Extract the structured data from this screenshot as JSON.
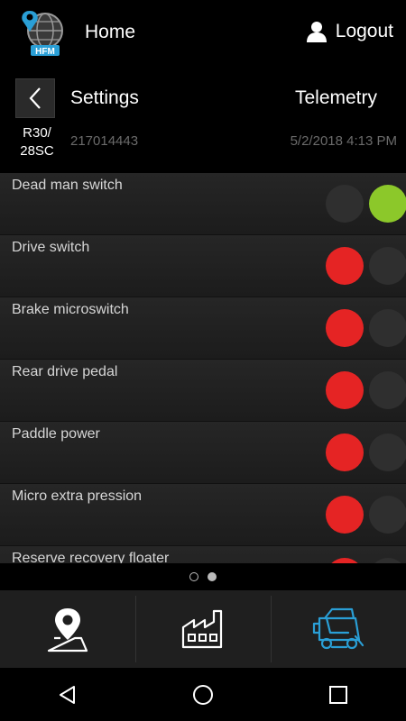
{
  "header": {
    "logo_text": "HFM",
    "home_label": "Home",
    "logout_label": "Logout"
  },
  "subheader": {
    "settings_label": "Settings",
    "telemetry_label": "Telemetry",
    "model": "R30/ 28SC",
    "serial": "217014443",
    "datetime": "5/2/2018 4:13 PM"
  },
  "colors": {
    "led_on_green": "#8cc82a",
    "led_on_red": "#e52424",
    "led_off": "#2f2f2f",
    "accent_blue": "#2a9fd6"
  },
  "switches": [
    {
      "label": "Dead man switch",
      "left": "off",
      "right": "green"
    },
    {
      "label": "Drive switch",
      "left": "red",
      "right": "off"
    },
    {
      "label": "Brake microswitch",
      "left": "red",
      "right": "off"
    },
    {
      "label": "Rear drive pedal",
      "left": "red",
      "right": "off"
    },
    {
      "label": "Paddle power",
      "left": "red",
      "right": "off"
    },
    {
      "label": "Micro extra pression",
      "left": "red",
      "right": "off"
    },
    {
      "label": "Reserve recovery floater",
      "left": "red",
      "right": "off"
    }
  ],
  "pager": {
    "pages": 2,
    "current": 2
  },
  "tabs": [
    {
      "icon": "map-pin-icon"
    },
    {
      "icon": "factory-icon"
    },
    {
      "icon": "scrubber-machine-icon",
      "active": true
    }
  ],
  "android_nav": [
    "back-icon",
    "home-icon",
    "recents-icon"
  ]
}
